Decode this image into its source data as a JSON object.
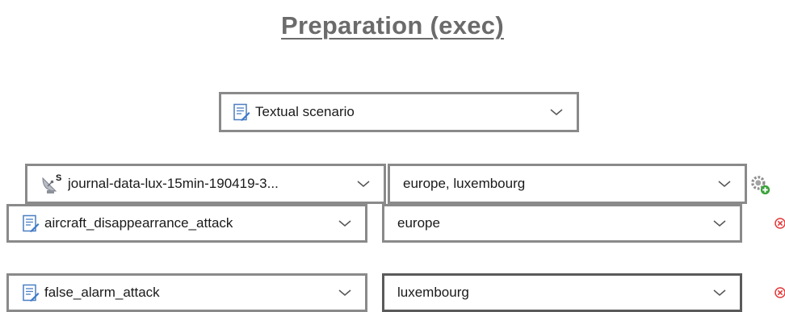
{
  "page": {
    "title": "Preparation (exec)"
  },
  "scenario_selector": {
    "value": "Textual scenario",
    "icon": "document-edit-icon"
  },
  "rows": [
    {
      "source": "journal-data-lux-15min-190419-3...",
      "source_icon": "satellite-dish-icon",
      "region": "europe, luxembourg",
      "action_icon": "settings-add-icon"
    },
    {
      "source": "aircraft_disappearrance_attack",
      "source_icon": "document-edit-icon",
      "region": "europe",
      "action_icon": "remove-icon"
    },
    {
      "source": "false_alarm_attack",
      "source_icon": "document-edit-icon",
      "region": "luxembourg",
      "action_icon": "remove-icon"
    }
  ],
  "colors": {
    "border": "#8a8a8a",
    "title": "#6b6b6b",
    "icon_blue": "#3c78c8",
    "remove_red": "#e03a3a"
  }
}
